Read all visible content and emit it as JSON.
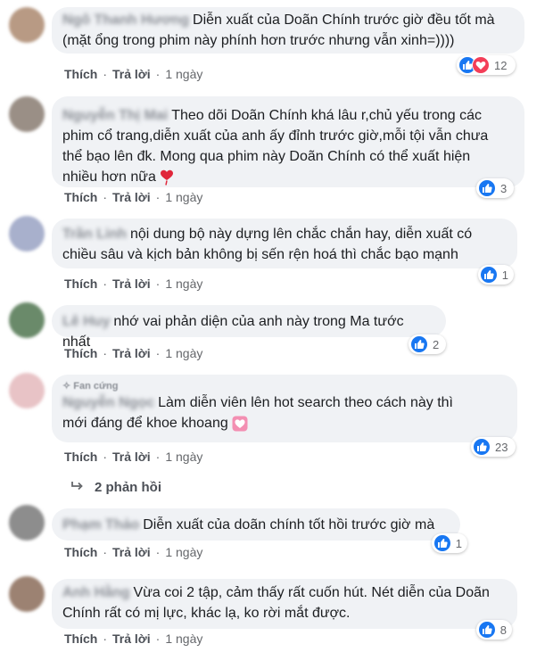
{
  "comments": [
    {
      "author": "Ngô Thanh Hương",
      "fan_badge": "",
      "text_lines": [
        "Diễn xuất của Doãn Chính trước giờ đều tốt mà",
        "(mặt ổng trong phim này phính hơn trước nhưng vẫn xinh=))))"
      ],
      "like": "Thích",
      "reply": "Trả lời",
      "time": "1 ngày",
      "reaction_count": "12",
      "reactions": [
        "like-icon",
        "love-icon"
      ],
      "avatar_color": "#b89a84"
    },
    {
      "author": "Nguyễn Thị Mai",
      "fan_badge": "",
      "text_lines": [
        "Theo dõi Doãn Chính khá lâu r,chủ yếu trong các",
        "phim cổ trang,diễn xuất của anh ấy đỉnh trước giờ,mỗi tội vẫn chưa",
        "thể bạo lên đk. Mong qua phim này Doãn Chính có thể xuất hiện",
        "nhiều hơn nữa"
      ],
      "like": "Thích",
      "reply": "Trả lời",
      "time": "1 ngày",
      "reaction_count": "3",
      "reactions": [
        "like-icon"
      ],
      "avatar_color": "#9a8f86"
    },
    {
      "author": "Trần Linh",
      "fan_badge": "",
      "text_lines": [
        "nội dung bộ này dựng lên chắc chắn hay, diễn xuất có",
        "chiều sâu và kịch bản không bị sến rện hoá thì chắc bạo mạnh"
      ],
      "like": "Thích",
      "reply": "Trả lời",
      "time": "1 ngày",
      "reaction_count": "1",
      "reactions": [
        "like-icon"
      ],
      "avatar_color": "#a8b0cc"
    },
    {
      "author": "Lê Huy",
      "fan_badge": "",
      "text_lines": [
        "nhớ vai phản diện của anh này trong Ma tước nhất"
      ],
      "like": "Thích",
      "reply": "Trả lời",
      "time": "1 ngày",
      "reaction_count": "2",
      "reactions": [
        "like-icon"
      ],
      "avatar_color": "#6a8a6a"
    },
    {
      "author": "Nguyễn Ngọc",
      "fan_badge": "Fan cứng",
      "text_lines": [
        "Làm diễn viên lên hot search theo cách này thì",
        "mới đáng để khoe khoang"
      ],
      "like": "Thích",
      "reply": "Trả lời",
      "time": "1 ngày",
      "reaction_count": "23",
      "reactions": [
        "like-icon"
      ],
      "avatar_color": "#e8c3c6"
    },
    {
      "author": "Phạm Thảo",
      "fan_badge": "",
      "text_lines": [
        "Diễn xuất của doãn chính tốt hồi trước giờ mà"
      ],
      "like": "Thích",
      "reply": "Trả lời",
      "time": "1 ngày",
      "reaction_count": "1",
      "reactions": [
        "like-icon"
      ],
      "avatar_color": "#8d8d8d"
    },
    {
      "author": "Anh Hằng",
      "fan_badge": "",
      "text_lines": [
        "Vừa coi 2 tập, cảm thấy rất cuốn hút. Nét diễn của Doãn",
        "Chính rất có mị lực, khác lạ, ko rời mắt được."
      ],
      "like": "Thích",
      "reply": "Trả lời",
      "time": "1 ngày",
      "reaction_count": "8",
      "reactions": [
        "like-icon"
      ],
      "avatar_color": "#9c8272"
    }
  ],
  "replies_link": "2 phản hồi",
  "colors": {
    "like_blue": "#1877f2",
    "love_red": "#f33e58",
    "bubble_bg": "#f0f2f5"
  }
}
